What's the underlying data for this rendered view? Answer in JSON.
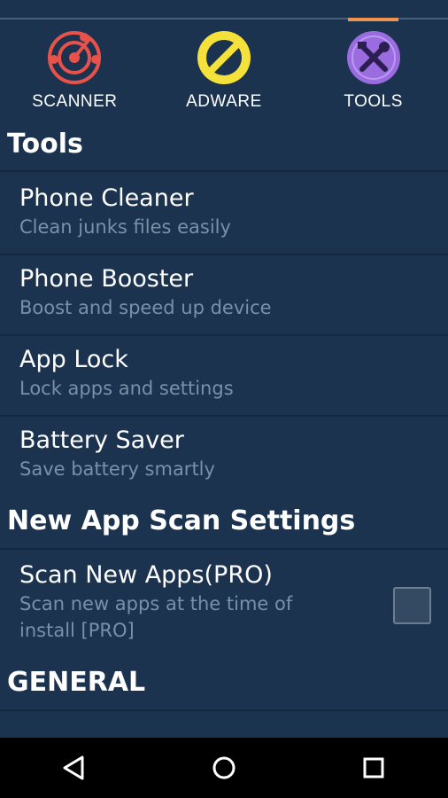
{
  "tabs": [
    {
      "label": "SCANNER",
      "icon": "radar-icon",
      "color": "#e8524a"
    },
    {
      "label": "ADWARE",
      "icon": "prohibited-icon",
      "color": "#f4e23a"
    },
    {
      "label": "TOOLS",
      "icon": "tools-icon",
      "color": "#9b6be0",
      "selected": true
    }
  ],
  "sections": {
    "tools": "Tools",
    "new_app_scan": "New App Scan Settings",
    "general": "GENERAL"
  },
  "tools_items": [
    {
      "title": "Phone Cleaner",
      "subtitle": "Clean junks files easily"
    },
    {
      "title": "Phone Booster",
      "subtitle": "Boost and speed up device"
    },
    {
      "title": "App Lock",
      "subtitle": "Lock apps and settings"
    },
    {
      "title": "Battery Saver",
      "subtitle": "Save battery smartly"
    }
  ],
  "scan_setting": {
    "title": "Scan New Apps(PRO)",
    "subtitle_line1": "Scan new apps at the time of",
    "subtitle_line2": "install [PRO]",
    "checked": false
  },
  "colors": {
    "background": "#1c3350",
    "accent": "#f0934e",
    "subtitle": "#7a90a8"
  },
  "navbar": [
    "back-icon",
    "home-icon",
    "recents-icon"
  ]
}
